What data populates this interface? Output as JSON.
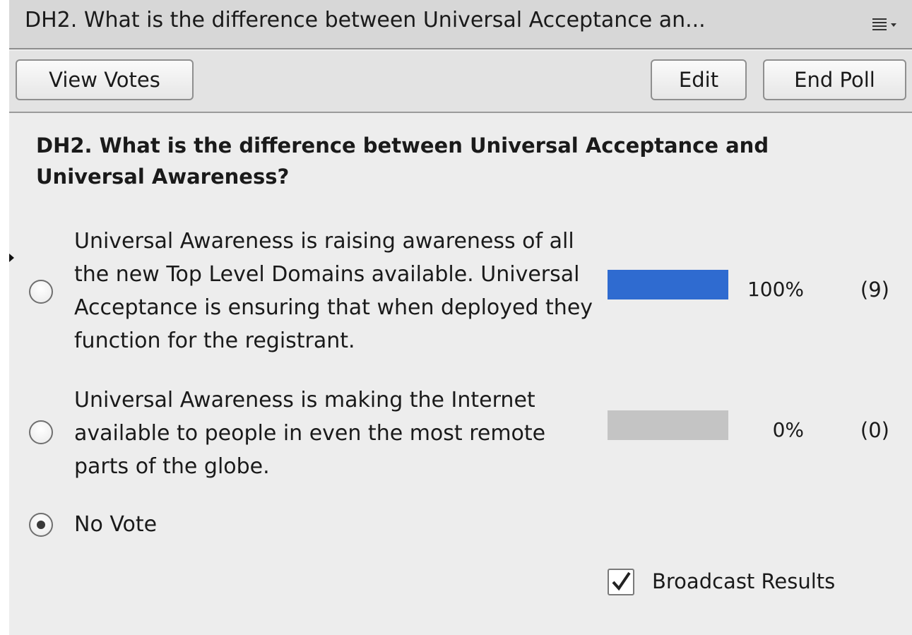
{
  "header": {
    "title": "DH2. What is the difference between Universal Acceptance an...",
    "menu_icon": "hamburger-menu-dropdown-icon"
  },
  "toolbar": {
    "view_votes_label": "View Votes",
    "edit_label": "Edit",
    "end_poll_label": "End Poll"
  },
  "poll": {
    "question": "DH2. What is the difference between Universal Acceptance and Universal Awareness?",
    "options": [
      {
        "text": "Universal Awareness is raising awareness of all the new Top Level Domains available. Universal Acceptance is ensuring that when deployed they function for the registrant.",
        "percent_label": "100%",
        "count_label": "(9)",
        "fraction": 1.0,
        "bar_color": "#2f6bd0",
        "selected": false
      },
      {
        "text": "Universal Awareness is making the Internet available to people in even the most remote parts of the globe.",
        "percent_label": "0%",
        "count_label": "(0)",
        "fraction": 0.0,
        "bar_color": "#2f6bd0",
        "selected": false
      },
      {
        "text": "No Vote",
        "selected": true
      }
    ]
  },
  "broadcast": {
    "label": "Broadcast Results",
    "checked": true
  },
  "colors": {
    "bar_empty": "#c4c4c4",
    "bar_fill": "#2f6bd0"
  }
}
